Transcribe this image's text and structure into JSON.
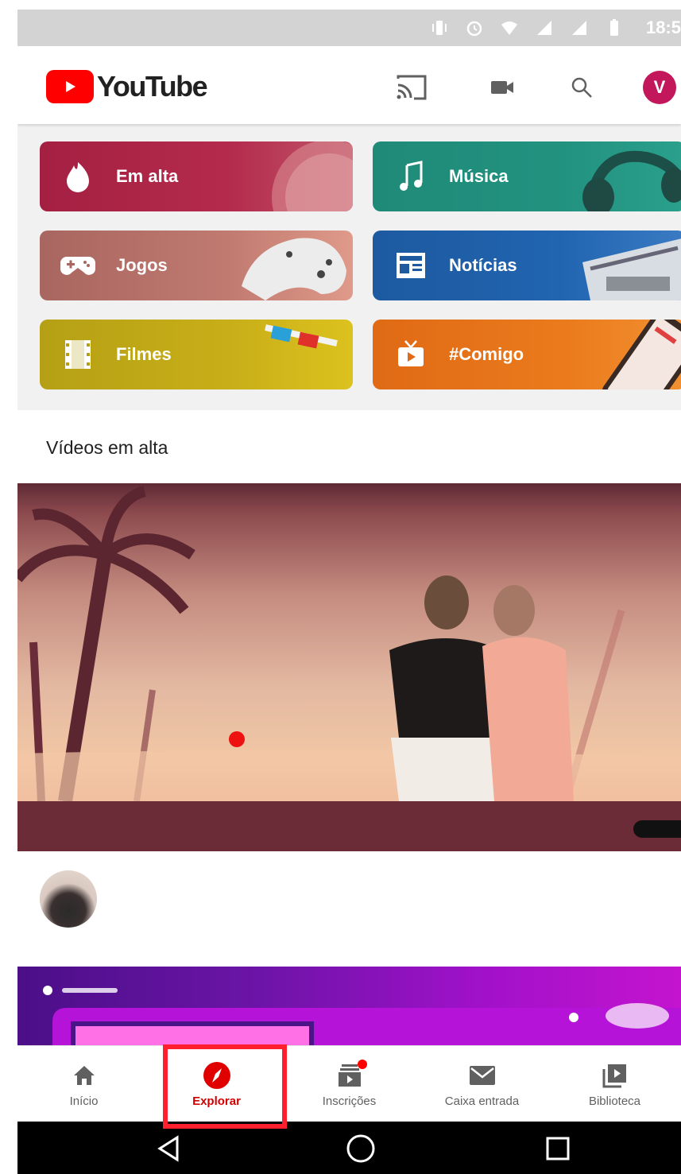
{
  "status_bar": {
    "time": "18:5"
  },
  "header": {
    "app_name": "YouTube",
    "avatar_letter": "V",
    "brand_color": "#ff0000"
  },
  "categories": [
    {
      "label": "Em alta",
      "icon": "flame-icon",
      "color": "#a42042"
    },
    {
      "label": "Música",
      "icon": "music-note-icon",
      "color": "#1f8a78"
    },
    {
      "label": "Jogos",
      "icon": "gamepad-icon",
      "color": "#a86660"
    },
    {
      "label": "Notícias",
      "icon": "newspaper-icon",
      "color": "#1d5aa0"
    },
    {
      "label": "Filmes",
      "icon": "film-strip-icon",
      "color": "#b5a015"
    },
    {
      "label": "#Comigo",
      "icon": "live-tv-icon",
      "color": "#e06a15"
    }
  ],
  "section": {
    "title": "Vídeos em alta"
  },
  "bottom_nav": {
    "items": [
      {
        "label": "Início",
        "icon": "home-icon"
      },
      {
        "label": "Explorar",
        "icon": "compass-icon",
        "active": true
      },
      {
        "label": "Inscrições",
        "icon": "subscriptions-icon",
        "badge": true
      },
      {
        "label": "Caixa entrada",
        "icon": "mail-icon"
      },
      {
        "label": "Biblioteca",
        "icon": "library-icon"
      }
    ],
    "active_color": "#d40000",
    "highlight_color": "#ff1f2e"
  },
  "system_nav": {
    "icons": [
      "back-triangle-icon",
      "home-circle-icon",
      "recents-square-icon"
    ]
  }
}
